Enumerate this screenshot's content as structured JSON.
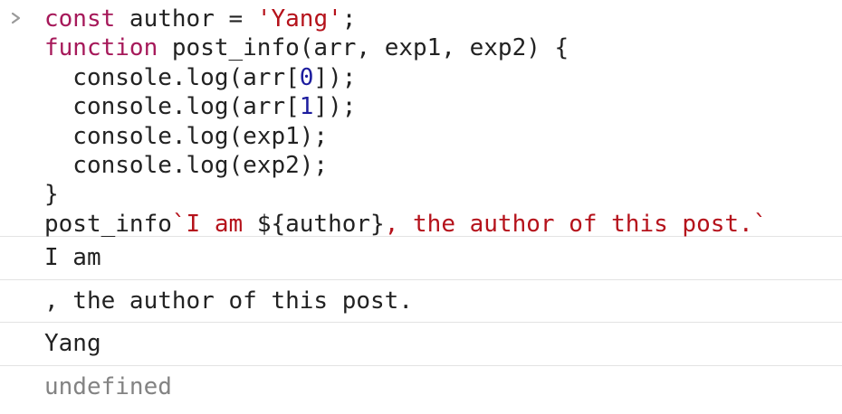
{
  "console": {
    "prompt_icon": "chevron-right-icon",
    "input_lines": [
      [
        {
          "t": "const",
          "c": "kw"
        },
        {
          "t": " author = ",
          "c": "plain"
        },
        {
          "t": "'Yang'",
          "c": "str"
        },
        {
          "t": ";",
          "c": "plain"
        }
      ],
      [
        {
          "t": "function",
          "c": "kw"
        },
        {
          "t": " post_info(arr, exp1, exp2) {",
          "c": "plain"
        }
      ],
      [
        {
          "t": "  console.log(arr[",
          "c": "plain"
        },
        {
          "t": "0",
          "c": "num"
        },
        {
          "t": "]);",
          "c": "plain"
        }
      ],
      [
        {
          "t": "  console.log(arr[",
          "c": "plain"
        },
        {
          "t": "1",
          "c": "num"
        },
        {
          "t": "]);",
          "c": "plain"
        }
      ],
      [
        {
          "t": "  console.log(exp1);",
          "c": "plain"
        }
      ],
      [
        {
          "t": "  console.log(exp2);",
          "c": "plain"
        }
      ],
      [
        {
          "t": "}",
          "c": "plain"
        }
      ],
      [
        {
          "t": "post_info",
          "c": "plain"
        },
        {
          "t": "`I am ",
          "c": "str"
        },
        {
          "t": "${author}",
          "c": "plain"
        },
        {
          "t": ", the author of this post.`",
          "c": "str"
        }
      ]
    ],
    "outputs": [
      {
        "text": "I am",
        "kind": "log"
      },
      {
        "text": ", the author of this post.",
        "kind": "log"
      },
      {
        "text": "Yang",
        "kind": "log"
      },
      {
        "text": "undefined",
        "kind": "result"
      }
    ],
    "colors": {
      "keyword": "#a6195a",
      "string": "#b5121b",
      "number": "#1c1c9e",
      "text": "#222222",
      "result": "#838383",
      "divider": "#e3e3e3",
      "prompt": "#9a9a9a"
    }
  }
}
